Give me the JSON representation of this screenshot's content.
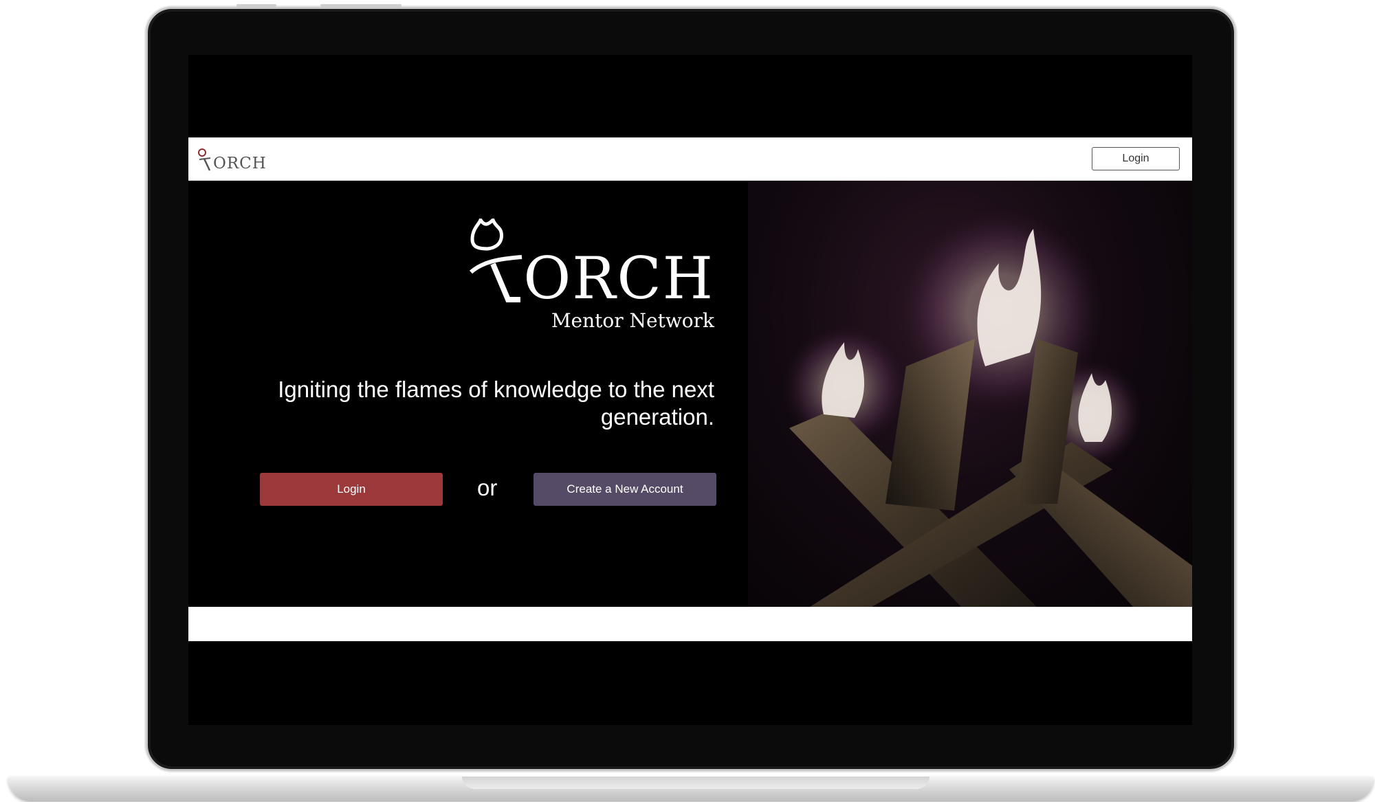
{
  "navbar": {
    "logo_text": "ORCH",
    "login_label": "Login"
  },
  "hero": {
    "brand_title": "ORCH",
    "brand_subtitle": "Mentor Network",
    "tagline": "Igniting the flames of knowledge to the next generation.",
    "login_button": "Login",
    "or_text": "or",
    "create_account_button": "Create a New Account",
    "image": "torch-flame-photo"
  },
  "colors": {
    "login_button": "#9b393b",
    "create_button": "#554b66",
    "logo_accent": "#8b2f33",
    "background": "#000000"
  }
}
